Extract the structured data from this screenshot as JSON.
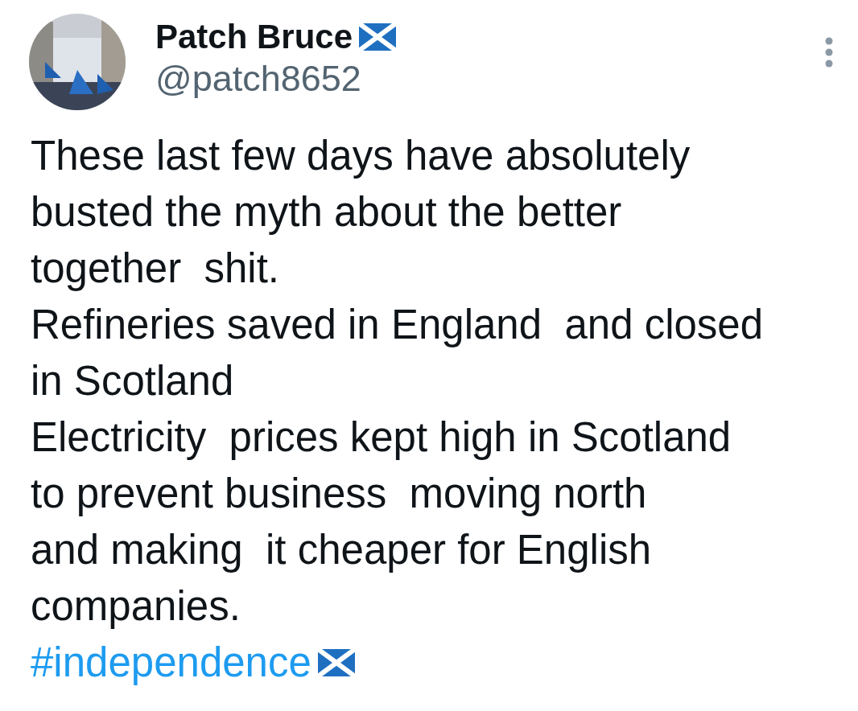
{
  "author": {
    "name": "Patch Bruce",
    "handle": "@patch8652"
  },
  "body": {
    "lines": [
      "These last few days have absolutely",
      "busted the myth about the better",
      "together  shit.",
      "Refineries saved in England  and closed",
      "in Scotland",
      "Electricity  prices kept high in Scotland",
      "to prevent business  moving north",
      "and making  it cheaper for English",
      "companies."
    ]
  },
  "hashtag": "#independence"
}
